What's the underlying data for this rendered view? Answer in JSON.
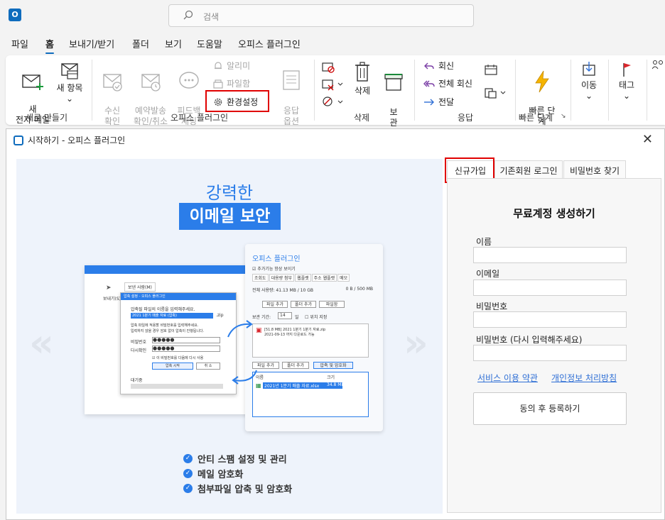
{
  "search": {
    "placeholder": "검색"
  },
  "menu": [
    "파일",
    "홈",
    "보내기/받기",
    "폴더",
    "보기",
    "도움말",
    "오피스 플러그인"
  ],
  "ribbon": {
    "new_mail": "새\n전자 메일",
    "new_item": "새 항목",
    "group_new": "새로 만들기",
    "receipt": "수신\n확인",
    "scheduled": "예약발송\n확인/취소",
    "feedback": "피드백\n채팅",
    "alarm": "알리미",
    "file_lock": "파일함",
    "settings": "환경설정",
    "reply_opts": "응답\n옵션",
    "group_plugin": "오피스 플러그인",
    "delete": "삭제",
    "archive": "보\n관",
    "group_delete": "삭제",
    "reply": "회신",
    "reply_all": "전체 회신",
    "forward": "전달",
    "group_respond": "응답",
    "quick_steps": "빠른 단\n계",
    "group_quick": "빠른 단계",
    "move": "이동",
    "tags": "태그"
  },
  "dialog": {
    "title": "시작하기 - 오피스 플러그인",
    "hero_line1": "강력한",
    "hero_line2": "이메일 보안",
    "features": [
      "안티 스팸 설정 및 관리",
      "메일 암호화",
      "첨부파일 압축 및 암호화"
    ],
    "mock": {
      "plugin_title": "오피스 플러그인",
      "show_always": "추가기능 항상 보이기",
      "tabs": [
        "조회도",
        "대용량 첨부",
        "웹플랫",
        "주소 웹플랫",
        "메모"
      ],
      "usage": "전체 사용량: 41.13 MB / 10 GB",
      "usage_right": "0 B / 500 MB",
      "btn_add_file": "파일 추가",
      "btn_add_folder": "폴더 추가",
      "btn_filebox": "파일함",
      "retention": "보관 기간:",
      "retention_val": "14",
      "retention_unit": "일",
      "location": "위치 지정",
      "attach_name": "[51.8 MB] 2021 1분기 1분기 자료.zip",
      "attach_date": "2021-09-13 까지 다운로드 가능",
      "btn_file_add2": "파일 추가",
      "btn_folder_add2": "폴더 추가",
      "btn_compress": "압축 및 암호화",
      "col_name": "이름",
      "col_size": "크기",
      "file_row": "2021년 1분기 매출 자료.xlsx",
      "file_size": "34.8 MB",
      "popup_title": "압축 설정 - 오피스 플러그인",
      "popup_line1": "압축될 파일의 이름을 입력해주세요.",
      "popup_zipname": "2021 1분기 매출 자료 (압축)",
      "popup_zip_ext": ".zip",
      "popup_line2": "압축 파일에 적용할 비밀번호를 입력해주세요.",
      "popup_line3": "입력하지 않을 경우 암호 없이 압축이 진행됩니다.",
      "popup_pw": "비밀번호",
      "popup_pw2": "다시확인",
      "popup_remember": "이 비밀번호를 다음에 다시 사용",
      "popup_start": "압축 시작",
      "popup_cancel": "취 소",
      "popup_wait": "대기중",
      "bg_send": "보내기(S)",
      "bg_select": "보낸 사람(M)"
    }
  },
  "form": {
    "tabs": [
      "신규가입",
      "기존회원 로그인",
      "비밀번호 찾기"
    ],
    "title": "무료계정 생성하기",
    "name_label": "이름",
    "email_label": "이메일",
    "pw_label": "비밀번호",
    "pw2_label": "비밀번호 (다시 입력해주세요)",
    "terms": "서비스 이용 약관",
    "privacy": "개인정보 처리방침",
    "submit": "동의 후 등록하기"
  },
  "colors": {
    "accent": "#0f6cbd",
    "brand_blue": "#2b7de9",
    "highlight": "#e00000"
  }
}
